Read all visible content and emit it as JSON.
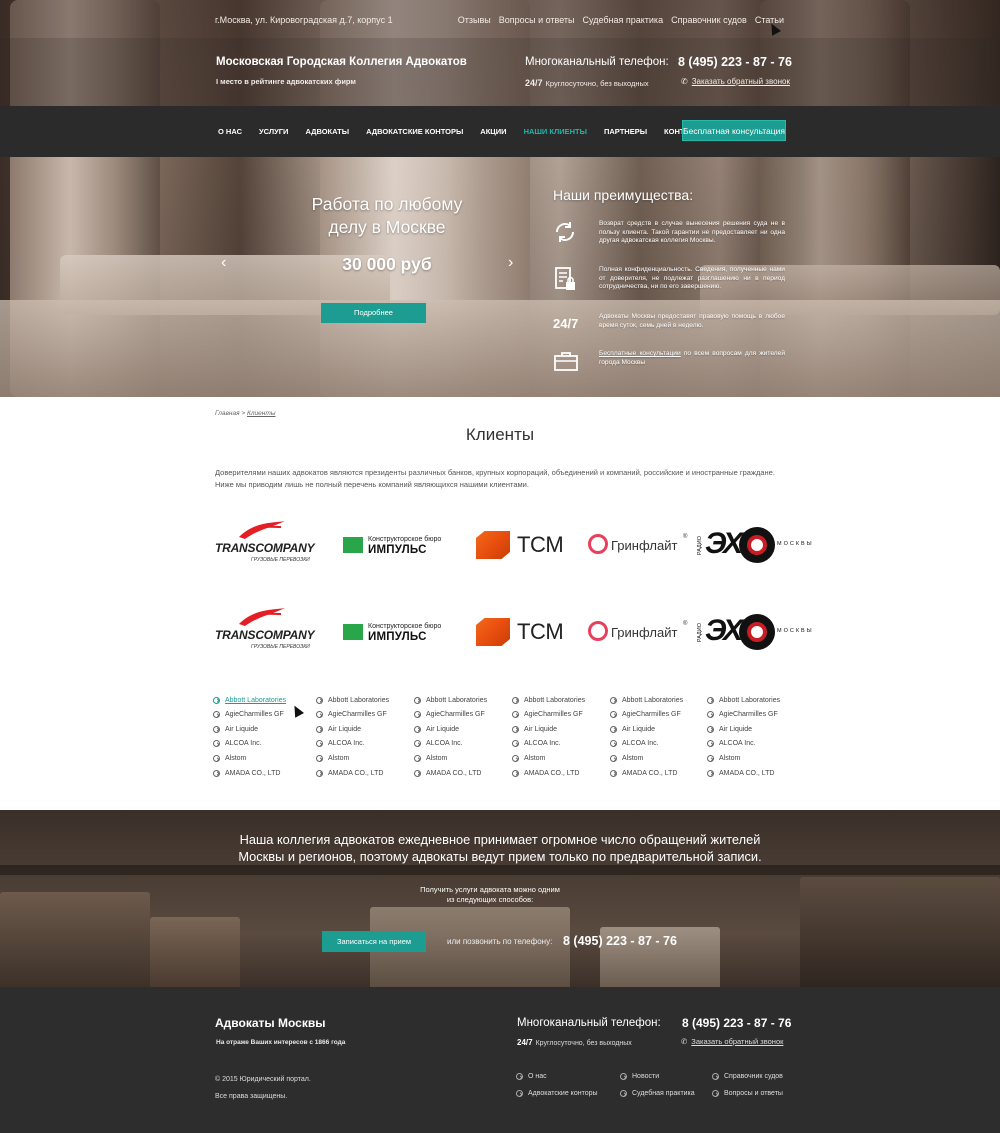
{
  "topbar": {
    "address": "г.Москва, ул. Кировоградская д.7, корпус 1",
    "nav": [
      "Отзывы",
      "Вопросы и ответы",
      "Судебная практика",
      "Справочник судов",
      "Статьи"
    ]
  },
  "header": {
    "brand": "Московская Городская Коллегия Адвокатов",
    "brand_sub": "I место в рейтинге адвокатских фирм",
    "phone_label": "Многоканальный телефон:",
    "phone": "8 (495) 223 - 87 - 76",
    "hours_bold": "24/7",
    "hours_text": "Круглосуточно, без выходных",
    "callback": "Заказать обратный звонок"
  },
  "mainnav": {
    "items": [
      "О нас",
      "Услуги",
      "Адвокаты",
      "Адвокатские конторы",
      "Акции",
      "Наши клиенты",
      "Партнеры",
      "Контакты"
    ],
    "active_index": 5,
    "consult_button": "Бесплатная консультация"
  },
  "hero": {
    "slide_title_line1": "Работа по любому",
    "slide_title_line2": "делу в Москве",
    "price": "30 000 руб",
    "prev_icon": "chevron-left-icon",
    "next_icon": "chevron-right-icon",
    "more_button": "Подробнее",
    "advantages_title": "Наши преимущества:",
    "advantages": [
      {
        "icon": "refresh-icon",
        "text": "Возврат средств в случае вынесения решения суда не в пользу клиента. Такой гарантии не предоставляет ни одна другая адвокатская коллегия Москвы."
      },
      {
        "icon": "document-lock-icon",
        "text": "Полная конфиденциальность. Сведения, полученные нами от доверителя, не подлежат разглашению ни в период сотрудничества, ни по его завершению."
      },
      {
        "icon": "24-7-icon",
        "icon_text": "24/7",
        "text": "Адвокаты Москвы предоставят правовую помощь в любое время суток, семь дней в неделю."
      },
      {
        "icon": "briefcase-icon",
        "link": "Бесплатные консультации",
        "text": " по всем вопросам для жителей города Москвы"
      }
    ]
  },
  "content": {
    "breadcrumb_home": "Главная",
    "breadcrumb_sep": " > ",
    "breadcrumb_current": "Клиенты",
    "title": "Клиенты",
    "intro": "Доверителями наших адвокатов являются президенты различных банков, крупных корпораций, объединений и компаний, российские и иностранные граждане. Ниже мы приводим лишь не полный перечень компаний являющихся нашими клиентами.",
    "logos": {
      "transcompany": {
        "name": "TRANSCOMPANY",
        "sub": "ГРУЗОВЫЕ ПЕРЕВОЗКИ"
      },
      "impuls": {
        "line1": "Конструкторское бюро",
        "line2": "ИМПУЛЬС"
      },
      "tcm": {
        "name": "TCM"
      },
      "grinflait": {
        "name": "Гринфлайт",
        "mark": "®"
      },
      "echo": {
        "pre": "РАДИО",
        "main": "ЭХ",
        "post": "МОСКВЫ"
      }
    },
    "clients_columns": [
      [
        "Abbott Laboratories",
        "AgieCharmilles GF",
        "Air Liquide",
        "ALCOA Inc.",
        "Alstom",
        "AMADA CO., LTD"
      ],
      [
        "Abbott Laboratories",
        "AgieCharmilles GF",
        "Air Liquide",
        "ALCOA Inc.",
        "Alstom",
        "AMADA CO., LTD"
      ],
      [
        "Abbott Laboratories",
        "AgieCharmilles GF",
        "Air Liquide",
        "ALCOA Inc.",
        "Alstom",
        "AMADA CO., LTD"
      ],
      [
        "Abbott Laboratories",
        "AgieCharmilles GF",
        "Air Liquide",
        "ALCOA Inc.",
        "Alstom",
        "AMADA CO., LTD"
      ],
      [
        "Abbott Laboratories",
        "AgieCharmilles GF",
        "Air Liquide",
        "ALCOA Inc.",
        "Alstom",
        "AMADA CO., LTD"
      ],
      [
        "Abbott Laboratories",
        "AgieCharmilles GF",
        "Air Liquide",
        "ALCOA Inc.",
        "Alstom",
        "AMADA CO., LTD"
      ]
    ]
  },
  "cta": {
    "headline_line1": "Наша коллегия адвокатов ежедневное принимает огромное число обращений жителей",
    "headline_line2": "Москвы и регионов, поэтому адвокаты ведут прием только по предварительной записи.",
    "sub_line1": "Получить услуги адвоката можно одним",
    "sub_line2": "из следующих способов:",
    "signup_button": "Записаться на прием",
    "call_text": "или позвонить по телефону:",
    "phone": "8 (495) 223 - 87 - 76"
  },
  "footer": {
    "brand": "Адвокаты Москвы",
    "sub": "На отраже Ваших интересов с 1866 года",
    "copyright": "© 2015  Юридический портал.",
    "rights": "Все права защищены.",
    "phone_label": "Многоканальный телефон:",
    "phone": "8 (495) 223 - 87 - 76",
    "hours_bold": "24/7",
    "hours_text": "Круглосуточно, без выходных",
    "callback": "Заказать обратный звонок",
    "links": [
      "О нас",
      "Новости",
      "Справочник судов",
      "Адвокатские конторы",
      "Судебная практика",
      "Вопросы и ответы"
    ]
  },
  "colors": {
    "accent": "#1d9d91",
    "nav_bg": "#2b2b2b",
    "footer_bg": "#2d2d2d"
  }
}
